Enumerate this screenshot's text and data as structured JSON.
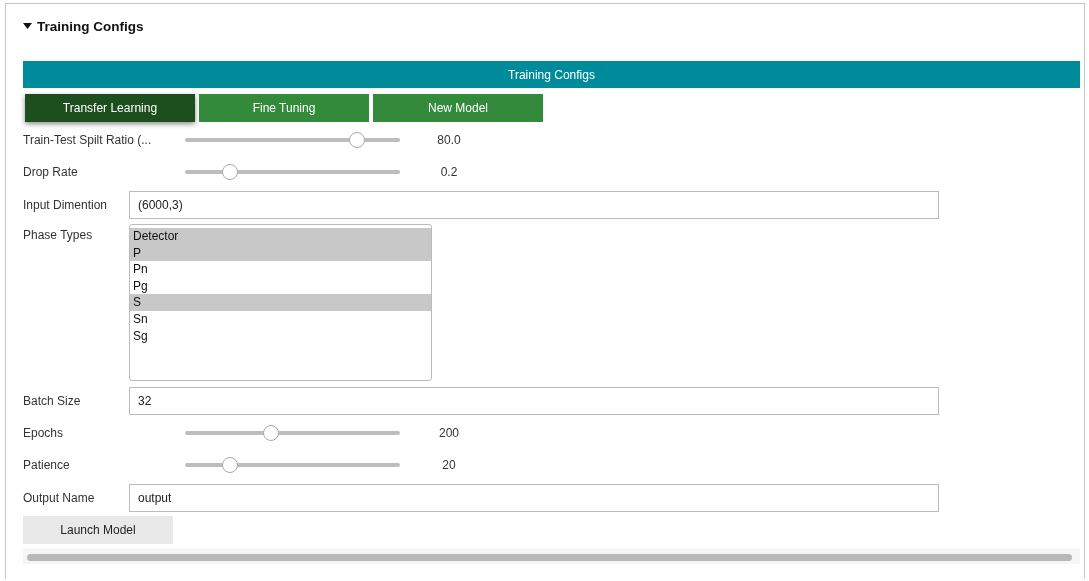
{
  "section": {
    "title": "Training Configs",
    "expanded": true
  },
  "banner": {
    "title": "Training Configs"
  },
  "tabs": [
    {
      "label": "Transfer Learning",
      "selected": true
    },
    {
      "label": "Fine Tuning",
      "selected": false
    },
    {
      "label": "New Model",
      "selected": false
    }
  ],
  "fields": [
    {
      "kind": "slider",
      "label": "Train-Test Spilt Ratio (...",
      "level": 0.8,
      "reading": "80.0"
    },
    {
      "kind": "slider",
      "label": "Drop Rate",
      "level": 0.21,
      "reading": "0.2"
    },
    {
      "kind": "text",
      "label": "Input Dimention",
      "value": "(6000,3)"
    },
    {
      "kind": "listbox",
      "label": "Phase Types",
      "options": [
        {
          "label": "Detector",
          "selected": true
        },
        {
          "label": "P",
          "selected": true
        },
        {
          "label": "Pn",
          "selected": false
        },
        {
          "label": "Pg",
          "selected": false
        },
        {
          "label": "S",
          "selected": true
        },
        {
          "label": "Sn",
          "selected": false
        },
        {
          "label": "Sg",
          "selected": false
        }
      ]
    },
    {
      "kind": "text",
      "label": "Batch Size",
      "value": "32"
    },
    {
      "kind": "slider",
      "label": "Epochs",
      "level": 0.4,
      "reading": "200"
    },
    {
      "kind": "slider",
      "label": "Patience",
      "level": 0.21,
      "reading": "20"
    },
    {
      "kind": "text",
      "label": "Output Name",
      "value": "output"
    }
  ],
  "launch_button": {
    "label": "Launch Model"
  }
}
